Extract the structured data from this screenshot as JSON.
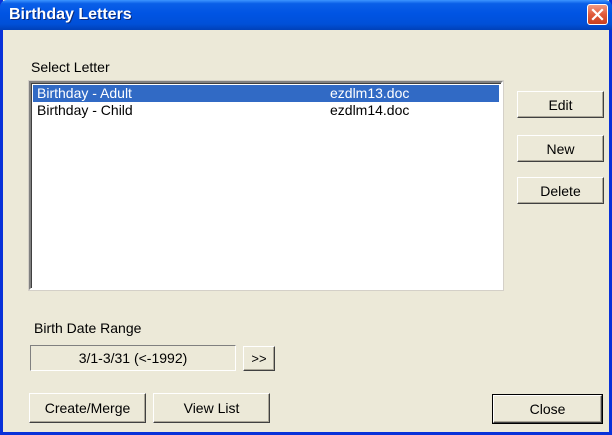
{
  "window": {
    "title": "Birthday Letters"
  },
  "letters": {
    "label": "Select Letter",
    "rows": [
      {
        "name": "Birthday - Adult",
        "file": "ezdlm13.doc",
        "selected": true
      },
      {
        "name": "Birthday - Child",
        "file": "ezdlm14.doc",
        "selected": false
      }
    ]
  },
  "side_buttons": {
    "edit": "Edit",
    "new": "New",
    "delete": "Delete"
  },
  "range": {
    "label": "Birth Date Range",
    "value": "3/1-3/31 (<-1992)",
    "more_button": ">>"
  },
  "bottom_buttons": {
    "create_merge": "Create/Merge",
    "view_list": "View List",
    "close": "Close"
  },
  "colors": {
    "title_bar": "#0054e3",
    "selection": "#316ac5",
    "dialog_bg": "#ece9d8",
    "close_button": "#e0593a"
  }
}
